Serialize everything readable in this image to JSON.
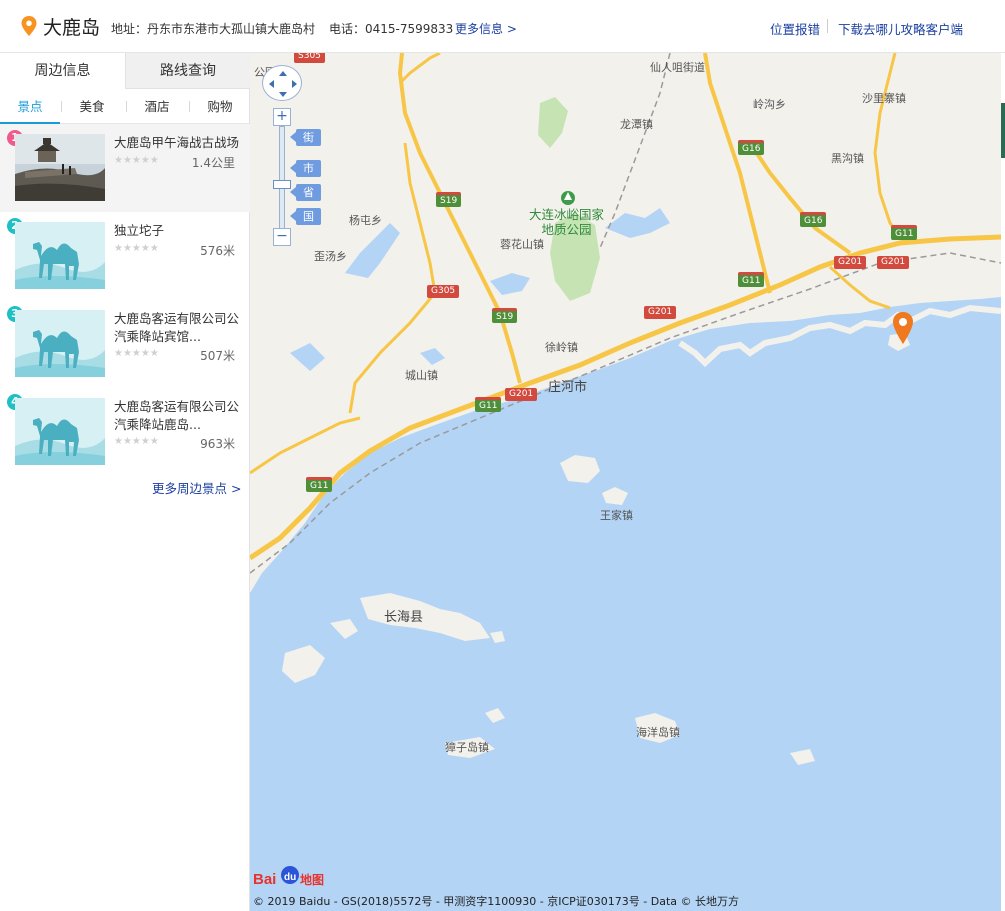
{
  "header": {
    "title": "大鹿岛",
    "address": "地址：丹东市东港市大孤山镇大鹿岛村",
    "phone": "电话：0415-7599833",
    "more_info": "更多信息 >",
    "report": "位置报错",
    "download": "下载去哪儿攻略客户端"
  },
  "sidebar": {
    "tabs": [
      {
        "label": "周边信息"
      },
      {
        "label": "路线查询"
      }
    ],
    "categories": [
      {
        "label": "景点"
      },
      {
        "label": "美食"
      },
      {
        "label": "酒店"
      },
      {
        "label": "购物"
      }
    ],
    "pois": [
      {
        "num": "1",
        "name": "大鹿岛甲午海战古战场",
        "stars": "★★★★★",
        "distance": "1.4公里"
      },
      {
        "num": "2",
        "name": "独立坨子",
        "stars": "★★★★★",
        "distance": "576米"
      },
      {
        "num": "3",
        "name": "大鹿岛客运有限公司公汽乘降站宾馆...",
        "stars": "★★★★★",
        "distance": "507米"
      },
      {
        "num": "4",
        "name": "大鹿岛客运有限公司公汽乘降站鹿岛...",
        "stars": "★★★★★",
        "distance": "963米"
      }
    ],
    "more": "更多周边景点 >"
  },
  "map": {
    "zoom_levels": [
      {
        "label": "街"
      },
      {
        "label": "市"
      },
      {
        "label": "省"
      },
      {
        "label": "国"
      }
    ],
    "labels": {
      "xianren": "仙人咀街道",
      "linggou": "岭沟乡",
      "shaliz": "沙里寨镇",
      "longtan": "龙潭镇",
      "heigou": "黑沟镇",
      "yangtun": "杨屯乡",
      "dalian_park": "大连冰峪国家\n地质公园",
      "ronghua": "蓉花山镇",
      "weitang": "歪汤乡",
      "xuling": "徐岭镇",
      "chengshan": "城山镇",
      "zhuanghe": "庄河市",
      "wangjia": "王家镇",
      "changhai": "长海县",
      "zhangzi": "獐子岛镇",
      "haiyang": "海洋岛镇",
      "park_edge": "公园"
    },
    "roads": {
      "s305a": "S305",
      "g16a": "G16",
      "s19a": "S19",
      "g16b": "G16",
      "g11a": "G11",
      "g305": "G305",
      "g201a": "G201",
      "g201b": "G201",
      "g11b": "G11",
      "s19b": "S19",
      "g201c": "G201",
      "g11c": "G11",
      "g201d": "G201",
      "g11d": "G11"
    },
    "logo": "Bai地图",
    "copyright": "© 2019 Baidu - GS(2018)5572号 - 甲测资字1100930 - 京ICP证030173号 - Data © 长地万方"
  },
  "colors": {
    "water": "#b3d4f5",
    "land": "#f3f1ec",
    "highway": "#f7c647",
    "accent": "#1b9bd7",
    "link": "#1a3fa0"
  }
}
